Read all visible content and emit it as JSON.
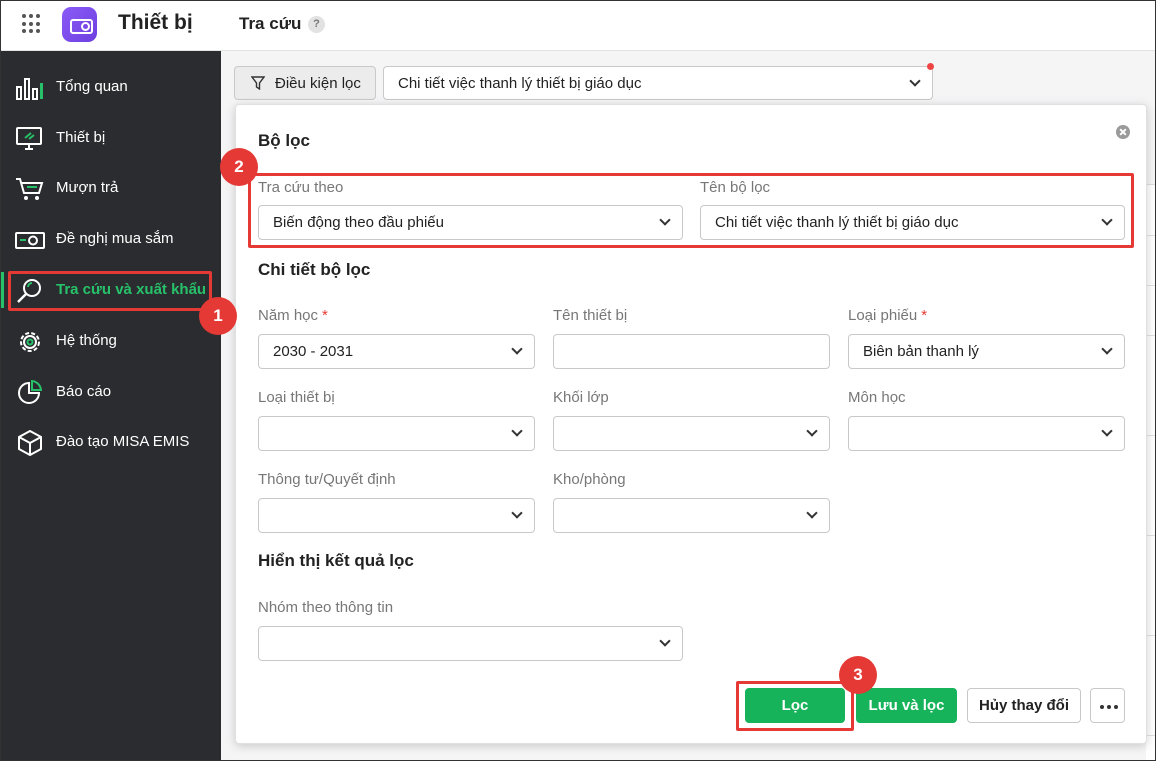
{
  "app": {
    "name": "Thiết bị",
    "page_title": "Tra cứu",
    "help_icon_text": "?"
  },
  "sidebar": {
    "items": [
      {
        "label": "Tổng quan",
        "icon": "bar-chart-icon"
      },
      {
        "label": "Thiết bị",
        "icon": "monitor-icon"
      },
      {
        "label": "Mượn trả",
        "icon": "cart-icon"
      },
      {
        "label": "Đề nghị mua sắm",
        "icon": "money-icon"
      },
      {
        "label": "Tra cứu và xuất khẩu",
        "icon": "search-icon",
        "active": true
      },
      {
        "label": "Hệ thống",
        "icon": "gear-icon"
      },
      {
        "label": "Báo cáo",
        "icon": "pie-chart-icon"
      },
      {
        "label": "Đào tạo MISA EMIS",
        "icon": "cube-icon"
      }
    ]
  },
  "toolbar": {
    "filter_button_label": "Điều kiện lọc",
    "preset_value": "Chi tiết việc thanh lý thiết bị giáo dục"
  },
  "panel": {
    "title": "Bộ lọc",
    "lookup_by_label": "Tra cứu theo",
    "lookup_by_value": "Biến động theo đầu phiếu",
    "filter_name_label": "Tên bộ lọc",
    "filter_name_value": "Chi tiết việc thanh lý thiết bị giáo dục",
    "detail_title": "Chi tiết bộ lọc",
    "fields": {
      "school_year_label": "Năm học",
      "school_year_value": "2030 - 2031",
      "required_mark": "*",
      "device_name_label": "Tên thiết bị",
      "device_name_value": "",
      "voucher_type_label": "Loại phiếu",
      "voucher_type_value": "Biên bản thanh lý",
      "device_type_label": "Loại thiết bị",
      "grade_label": "Khối lớp",
      "subject_label": "Môn học",
      "circular_label": "Thông tư/Quyết định",
      "warehouse_label": "Kho/phòng"
    },
    "result_title": "Hiển thị kết quả lọc",
    "group_by_label": "Nhóm theo thông tin",
    "buttons": {
      "filter": "Lọc",
      "save_filter": "Lưu và lọc",
      "cancel_changes": "Hủy thay đổi"
    }
  },
  "annotations": {
    "badge_1": "1",
    "badge_2": "2",
    "badge_3": "3"
  },
  "colors": {
    "accent_green": "#16b35a",
    "sidebar_bg": "#2b2c2f",
    "highlight_red": "#e53935",
    "app_logo_purple": "#7c4dff"
  }
}
